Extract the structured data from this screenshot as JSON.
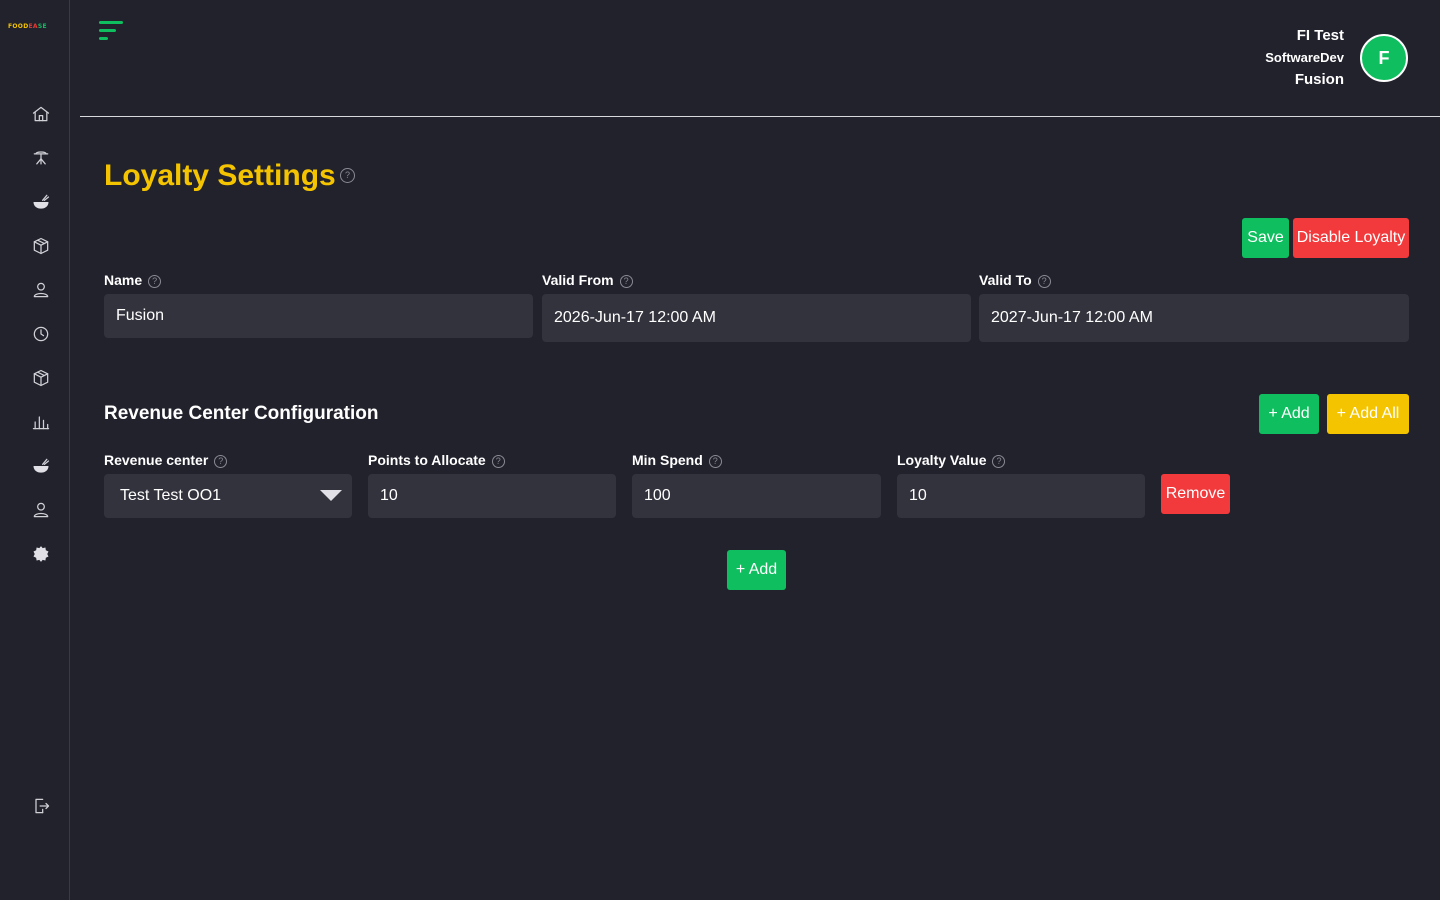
{
  "brand": {
    "logo_part1": "FOOD",
    "logo_part2": "EA",
    "logo_part3": "SE"
  },
  "sidebar": {
    "items": [
      {
        "icon": "home-icon"
      },
      {
        "icon": "dining-table-icon"
      },
      {
        "icon": "food-bowl-icon"
      },
      {
        "icon": "box-icon"
      },
      {
        "icon": "user-icon"
      },
      {
        "icon": "clock-icon"
      },
      {
        "icon": "package-icon"
      },
      {
        "icon": "bar-chart-icon"
      },
      {
        "icon": "food-tray-icon"
      },
      {
        "icon": "person-icon"
      },
      {
        "icon": "gear-icon"
      }
    ],
    "logout_icon": "logout-icon"
  },
  "header": {
    "user_name": "FI Test",
    "user_org": "SoftwareDev",
    "user_venue": "Fusion",
    "avatar_letter": "F"
  },
  "page": {
    "title": "Loyalty Settings",
    "help_glyph": "?"
  },
  "actions": {
    "save": "Save",
    "disable": "Disable Loyalty"
  },
  "form": {
    "name_label": "Name",
    "name_value": "Fusion",
    "valid_from_label": "Valid From",
    "valid_from_value": "2026-Jun-17 12:00 AM",
    "valid_to_label": "Valid To",
    "valid_to_value": "2027-Jun-17 12:00 AM"
  },
  "revenue": {
    "section_title": "Revenue Center Configuration",
    "add": "+ Add",
    "add_all": "+ Add All",
    "columns": {
      "revenue_center": "Revenue center",
      "points": "Points to Allocate",
      "min_spend": "Min Spend",
      "loyalty_value": "Loyalty Value"
    },
    "rows": [
      {
        "revenue_center": "Test Test OO1",
        "points": "10",
        "min_spend": "100",
        "loyalty_value": "10",
        "remove": "Remove"
      }
    ],
    "add_row": "+ Add"
  },
  "colors": {
    "background": "#22222d",
    "accent_green": "#0fbf5f",
    "accent_yellow": "#f5c400",
    "danger_red": "#f23a3c",
    "input_bg": "#33333d"
  }
}
